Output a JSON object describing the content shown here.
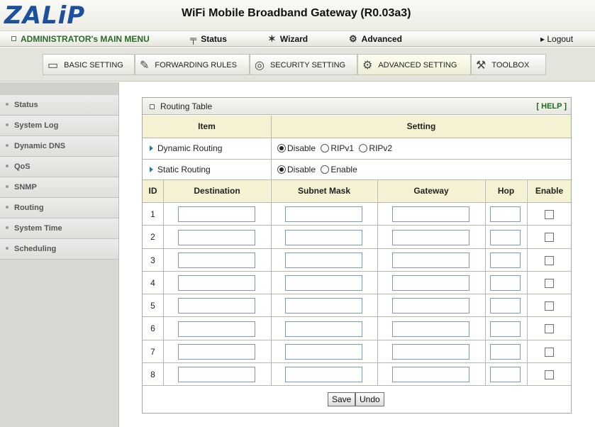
{
  "header": {
    "logo_text": "ZALiP",
    "title": "WiFi Mobile Broadband Gateway (R0.03a3)"
  },
  "topmenu": {
    "admin": "ADMINISTRATOR's MAIN MENU",
    "status": "Status",
    "wizard": "Wizard",
    "advanced": "Advanced",
    "logout": "▸ Logout"
  },
  "tabs": [
    {
      "label": "BASIC SETTING",
      "icon": "folder-icon"
    },
    {
      "label": "FORWARDING RULES",
      "icon": "pen-icon"
    },
    {
      "label": "SECURITY SETTING",
      "icon": "shield-icon"
    },
    {
      "label": "ADVANCED SETTING",
      "icon": "gear-icon",
      "active": true
    },
    {
      "label": "TOOLBOX",
      "icon": "toolbox-icon"
    }
  ],
  "sidebar": {
    "items": [
      "Status",
      "System Log",
      "Dynamic DNS",
      "QoS",
      "SNMP",
      "Routing",
      "System Time",
      "Scheduling"
    ]
  },
  "panel": {
    "title": "Routing Table",
    "help": "[ HELP ]",
    "col_item": "Item",
    "col_setting": "Setting",
    "dynamic_label": "Dynamic Routing",
    "dynamic_options": [
      "Disable",
      "RIPv1",
      "RIPv2"
    ],
    "dynamic_selected": "Disable",
    "static_label": "Static Routing",
    "static_options": [
      "Disable",
      "Enable"
    ],
    "static_selected": "Disable",
    "table_headers": [
      "ID",
      "Destination",
      "Subnet Mask",
      "Gateway",
      "Hop",
      "Enable"
    ],
    "rows": [
      {
        "id": "1",
        "destination": "",
        "subnet": "",
        "gateway": "",
        "hop": "",
        "enabled": false
      },
      {
        "id": "2",
        "destination": "",
        "subnet": "",
        "gateway": "",
        "hop": "",
        "enabled": false
      },
      {
        "id": "3",
        "destination": "",
        "subnet": "",
        "gateway": "",
        "hop": "",
        "enabled": false
      },
      {
        "id": "4",
        "destination": "",
        "subnet": "",
        "gateway": "",
        "hop": "",
        "enabled": false
      },
      {
        "id": "5",
        "destination": "",
        "subnet": "",
        "gateway": "",
        "hop": "",
        "enabled": false
      },
      {
        "id": "6",
        "destination": "",
        "subnet": "",
        "gateway": "",
        "hop": "",
        "enabled": false
      },
      {
        "id": "7",
        "destination": "",
        "subnet": "",
        "gateway": "",
        "hop": "",
        "enabled": false
      },
      {
        "id": "8",
        "destination": "",
        "subnet": "",
        "gateway": "",
        "hop": "",
        "enabled": false
      }
    ],
    "save_label": "Save",
    "undo_label": "Undo"
  },
  "colors": {
    "logo_blue": "#1c4f9c",
    "header_bg": "#f4f2d3",
    "help_green": "#1a6a1a"
  }
}
